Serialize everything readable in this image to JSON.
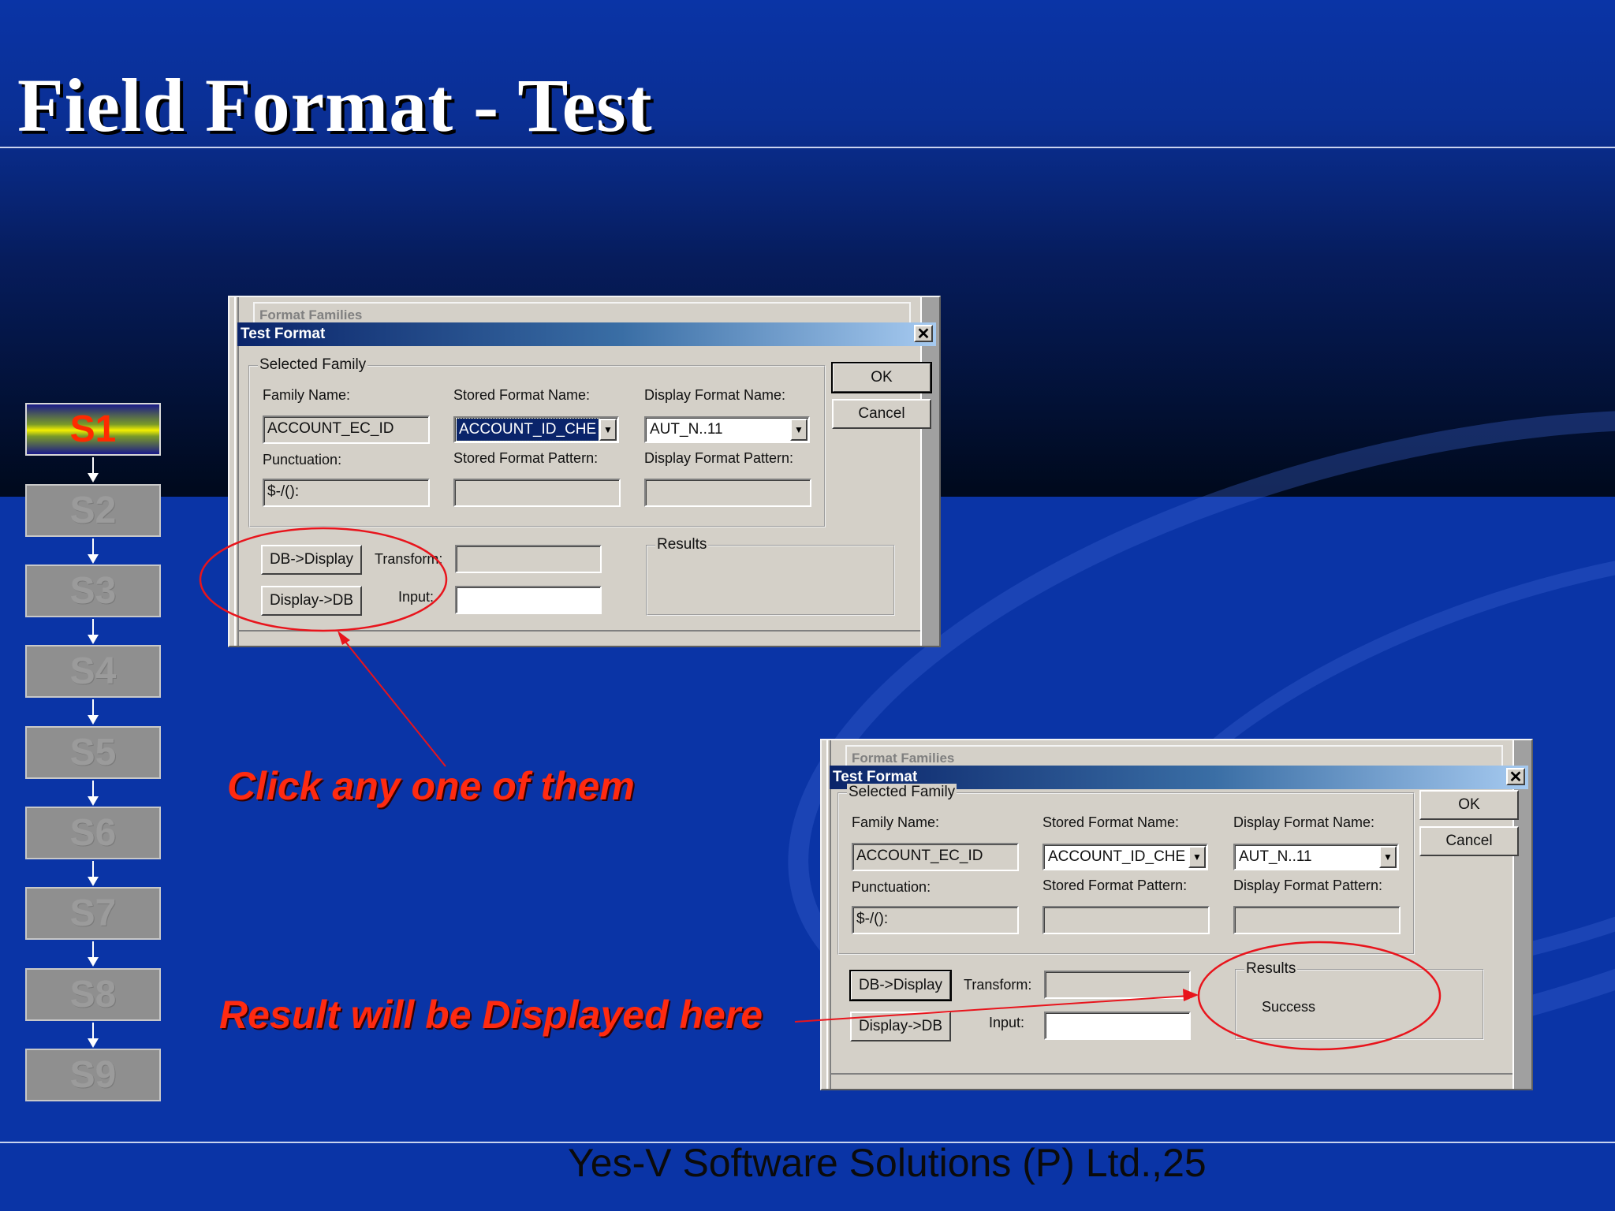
{
  "slide": {
    "title": "Field Format - Test",
    "footer": "Yes-V Software Solutions (P) Ltd.,25"
  },
  "steps": [
    {
      "label": "S1",
      "active": true
    },
    {
      "label": "S2",
      "active": false
    },
    {
      "label": "S3",
      "active": false
    },
    {
      "label": "S4",
      "active": false
    },
    {
      "label": "S5",
      "active": false
    },
    {
      "label": "S6",
      "active": false
    },
    {
      "label": "S7",
      "active": false
    },
    {
      "label": "S8",
      "active": false
    },
    {
      "label": "S9",
      "active": false
    }
  ],
  "dialog_top": {
    "background_tab": "Format Families",
    "title": "Test Format",
    "close_symbol": "✕",
    "group_label": "Selected Family",
    "family_name_label": "Family Name:",
    "family_name_value": "ACCOUNT_EC_ID",
    "stored_format_name_label": "Stored Format Name:",
    "stored_format_name_value": "ACCOUNT_ID_CHE",
    "display_format_name_label": "Display Format Name:",
    "display_format_name_value": "AUT_N..11",
    "punctuation_label": "Punctuation:",
    "punctuation_value": "$-/():",
    "stored_format_pattern_label": "Stored Format Pattern:",
    "stored_format_pattern_value": "",
    "display_format_pattern_label": "Display Format Pattern:",
    "display_format_pattern_value": "",
    "ok_label": "OK",
    "cancel_label": "Cancel",
    "db_display_label": "DB->Display",
    "display_db_label": "Display->DB",
    "transform_label": "Transform:",
    "transform_value": "",
    "input_label": "Input:",
    "input_value": "",
    "results_label": "Results",
    "results_value": ""
  },
  "dialog_bottom": {
    "background_tab": "Format Families",
    "title": "Test Format",
    "close_symbol": "✕",
    "group_label": "Selected Family",
    "family_name_label": "Family Name:",
    "family_name_value": "ACCOUNT_EC_ID",
    "stored_format_name_label": "Stored Format Name:",
    "stored_format_name_value": "ACCOUNT_ID_CHE",
    "display_format_name_label": "Display Format Name:",
    "display_format_name_value": "AUT_N..11",
    "punctuation_label": "Punctuation:",
    "punctuation_value": "$-/():",
    "stored_format_pattern_label": "Stored Format Pattern:",
    "stored_format_pattern_value": "",
    "display_format_pattern_label": "Display Format Pattern:",
    "display_format_pattern_value": "",
    "ok_label": "OK",
    "cancel_label": "Cancel",
    "db_display_label": "DB->Display",
    "display_db_label": "Display->DB",
    "transform_label": "Transform:",
    "transform_value": "",
    "input_label": "Input:",
    "input_value": "",
    "results_label": "Results",
    "results_value": "Success"
  },
  "annotations": {
    "click_hint": "Click any one of them",
    "result_hint": "Result will be Displayed here"
  },
  "colors": {
    "background_blue": "#0a34a6",
    "annotation_red": "#ff2a10",
    "titlebar_dark": "#0a246a",
    "dialog_face": "#d4d0c8",
    "active_step_text": "#ff2a00"
  }
}
